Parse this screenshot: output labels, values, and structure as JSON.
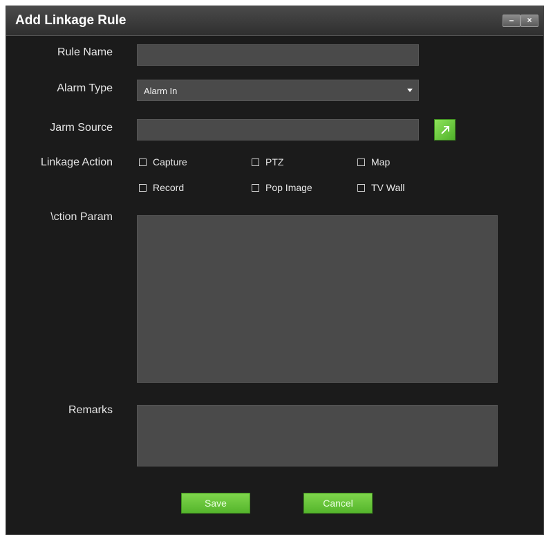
{
  "window": {
    "title": "Add Linkage Rule",
    "minimize_glyph": "–",
    "close_glyph": "×"
  },
  "form": {
    "rule_name": {
      "label": "Rule Name",
      "value": ""
    },
    "alarm_type": {
      "label": "Alarm Type",
      "value": "Alarm In"
    },
    "alarm_source": {
      "label": "Jarm Source",
      "value": ""
    },
    "linkage_action": {
      "label": "Linkage Action",
      "options": [
        {
          "label": "Capture",
          "checked": false
        },
        {
          "label": "PTZ",
          "checked": false
        },
        {
          "label": "Map",
          "checked": false
        },
        {
          "label": "Record",
          "checked": false
        },
        {
          "label": "Pop Image",
          "checked": false
        },
        {
          "label": "TV Wall",
          "checked": false
        }
      ]
    },
    "action_param": {
      "label": "\\ction Param",
      "value": ""
    },
    "remarks": {
      "label": "Remarks",
      "value": ""
    }
  },
  "buttons": {
    "save": "Save",
    "cancel": "Cancel"
  },
  "icons": {
    "browse": "browse-source-icon"
  },
  "colors": {
    "dialog_bg": "#1b1b1b",
    "field_bg": "#4a4a4a",
    "accent_green": "#6cc83d"
  }
}
